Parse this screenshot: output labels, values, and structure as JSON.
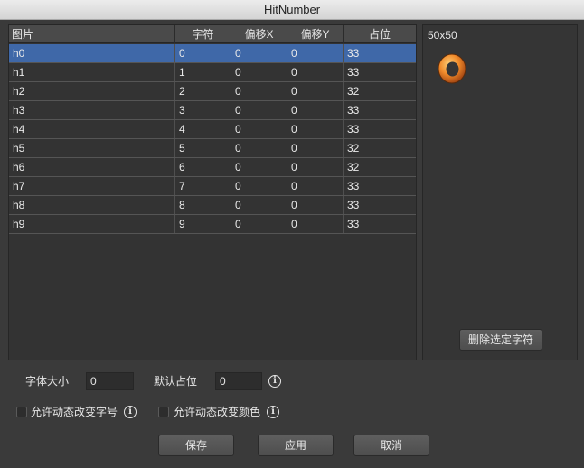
{
  "window": {
    "title": "HitNumber"
  },
  "table": {
    "columns": [
      "图片",
      "字符",
      "偏移X",
      "偏移Y",
      "占位"
    ],
    "rows": [
      [
        "h0",
        "0",
        "0",
        "0",
        "33"
      ],
      [
        "h1",
        "1",
        "0",
        "0",
        "33"
      ],
      [
        "h2",
        "2",
        "0",
        "0",
        "32"
      ],
      [
        "h3",
        "3",
        "0",
        "0",
        "33"
      ],
      [
        "h4",
        "4",
        "0",
        "0",
        "33"
      ],
      [
        "h5",
        "5",
        "0",
        "0",
        "32"
      ],
      [
        "h6",
        "6",
        "0",
        "0",
        "32"
      ],
      [
        "h7",
        "7",
        "0",
        "0",
        "33"
      ],
      [
        "h8",
        "8",
        "0",
        "0",
        "33"
      ],
      [
        "h9",
        "9",
        "0",
        "0",
        "33"
      ]
    ],
    "selected_index": 0
  },
  "preview": {
    "size_label": "50x50",
    "image_icon": "orange-ring-glyph",
    "delete_button": "删除选定字符"
  },
  "settings": {
    "font_size_label": "字体大小",
    "font_size_value": "0",
    "default_advance_label": "默认占位",
    "default_advance_value": "0",
    "allow_dynamic_size_label": "允许动态改变字号",
    "allow_dynamic_size_checked": false,
    "allow_dynamic_color_label": "允许动态改变颜色",
    "allow_dynamic_color_checked": false,
    "info_glyph": "i"
  },
  "buttons": {
    "save": "保存",
    "apply": "应用",
    "cancel": "取消"
  },
  "colors": {
    "background": "#3a3a3a",
    "selection": "#3f68a8",
    "ring_orange": "#f08a2a"
  }
}
